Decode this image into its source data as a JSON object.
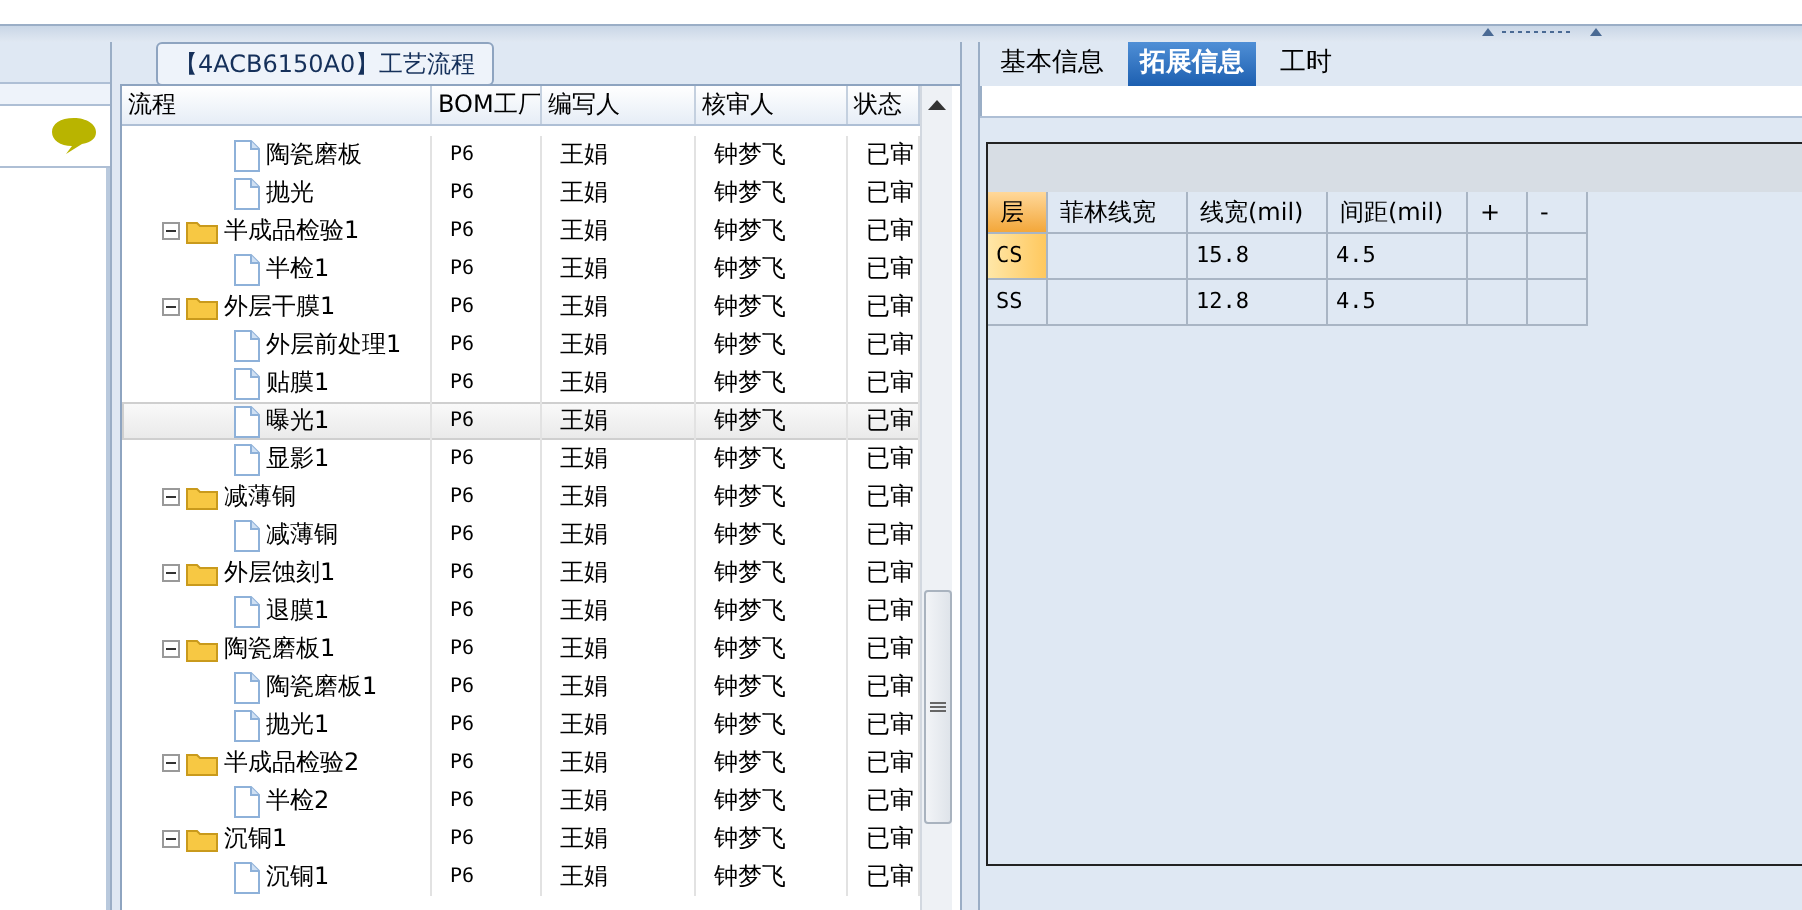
{
  "group_title": "【4ACB6150A0】工艺流程",
  "flow_table": {
    "columns": [
      "流程",
      "BOM工厂",
      "编写人",
      "核审人",
      "状态"
    ],
    "groups": [
      {
        "children": [
          {
            "name": "陶瓷磨板",
            "factory": "P6",
            "writer": "王娟",
            "reviewer": "钟梦飞",
            "status": "已审",
            "selected": false
          },
          {
            "name": "抛光",
            "factory": "P6",
            "writer": "王娟",
            "reviewer": "钟梦飞",
            "status": "已审",
            "selected": false
          }
        ]
      },
      {
        "name": "半成品检验1",
        "factory": "P6",
        "writer": "王娟",
        "reviewer": "钟梦飞",
        "status": "已审",
        "selected": false,
        "expanded": true,
        "children": [
          {
            "name": "半检1",
            "factory": "P6",
            "writer": "王娟",
            "reviewer": "钟梦飞",
            "status": "已审",
            "selected": false
          }
        ]
      },
      {
        "name": "外层干膜1",
        "factory": "P6",
        "writer": "王娟",
        "reviewer": "钟梦飞",
        "status": "已审",
        "selected": false,
        "expanded": true,
        "children": [
          {
            "name": "外层前处理1",
            "factory": "P6",
            "writer": "王娟",
            "reviewer": "钟梦飞",
            "status": "已审",
            "selected": false
          },
          {
            "name": "贴膜1",
            "factory": "P6",
            "writer": "王娟",
            "reviewer": "钟梦飞",
            "status": "已审",
            "selected": false
          },
          {
            "name": "曝光1",
            "factory": "P6",
            "writer": "王娟",
            "reviewer": "钟梦飞",
            "status": "已审",
            "selected": true
          },
          {
            "name": "显影1",
            "factory": "P6",
            "writer": "王娟",
            "reviewer": "钟梦飞",
            "status": "已审",
            "selected": false
          }
        ]
      },
      {
        "name": "减薄铜",
        "factory": "P6",
        "writer": "王娟",
        "reviewer": "钟梦飞",
        "status": "已审",
        "selected": false,
        "expanded": true,
        "children": [
          {
            "name": "减薄铜",
            "factory": "P6",
            "writer": "王娟",
            "reviewer": "钟梦飞",
            "status": "已审",
            "selected": false
          }
        ]
      },
      {
        "name": "外层蚀刻1",
        "factory": "P6",
        "writer": "王娟",
        "reviewer": "钟梦飞",
        "status": "已审",
        "selected": false,
        "expanded": true,
        "children": [
          {
            "name": "退膜1",
            "factory": "P6",
            "writer": "王娟",
            "reviewer": "钟梦飞",
            "status": "已审",
            "selected": false
          }
        ]
      },
      {
        "name": "陶瓷磨板1",
        "factory": "P6",
        "writer": "王娟",
        "reviewer": "钟梦飞",
        "status": "已审",
        "selected": false,
        "expanded": true,
        "children": [
          {
            "name": "陶瓷磨板1",
            "factory": "P6",
            "writer": "王娟",
            "reviewer": "钟梦飞",
            "status": "已审",
            "selected": false
          },
          {
            "name": "抛光1",
            "factory": "P6",
            "writer": "王娟",
            "reviewer": "钟梦飞",
            "status": "已审",
            "selected": false
          }
        ]
      },
      {
        "name": "半成品检验2",
        "factory": "P6",
        "writer": "王娟",
        "reviewer": "钟梦飞",
        "status": "已审",
        "selected": false,
        "expanded": true,
        "children": [
          {
            "name": "半检2",
            "factory": "P6",
            "writer": "王娟",
            "reviewer": "钟梦飞",
            "status": "已审",
            "selected": false
          }
        ]
      },
      {
        "name": "沉铜1",
        "factory": "P6",
        "writer": "王娟",
        "reviewer": "钟梦飞",
        "status": "已审",
        "selected": false,
        "expanded": true,
        "children": [
          {
            "name": "沉铜1",
            "factory": "P6",
            "writer": "王娟",
            "reviewer": "钟梦飞",
            "status": "已审",
            "selected": false
          }
        ]
      }
    ]
  },
  "tabs": [
    {
      "label": "基本信息",
      "selected": false
    },
    {
      "label": "拓展信息",
      "selected": true
    },
    {
      "label": "工时",
      "selected": false
    }
  ],
  "layer_table": {
    "columns": [
      "层",
      "菲林线宽",
      "线宽(mil)",
      "间距(mil)",
      "+",
      "-"
    ],
    "rows": [
      {
        "cells": [
          "CS",
          "",
          "15.8",
          "4.5",
          "",
          ""
        ],
        "selected": true
      },
      {
        "cells": [
          "SS",
          "",
          "12.8",
          "4.5",
          "",
          ""
        ],
        "selected": false
      }
    ]
  }
}
